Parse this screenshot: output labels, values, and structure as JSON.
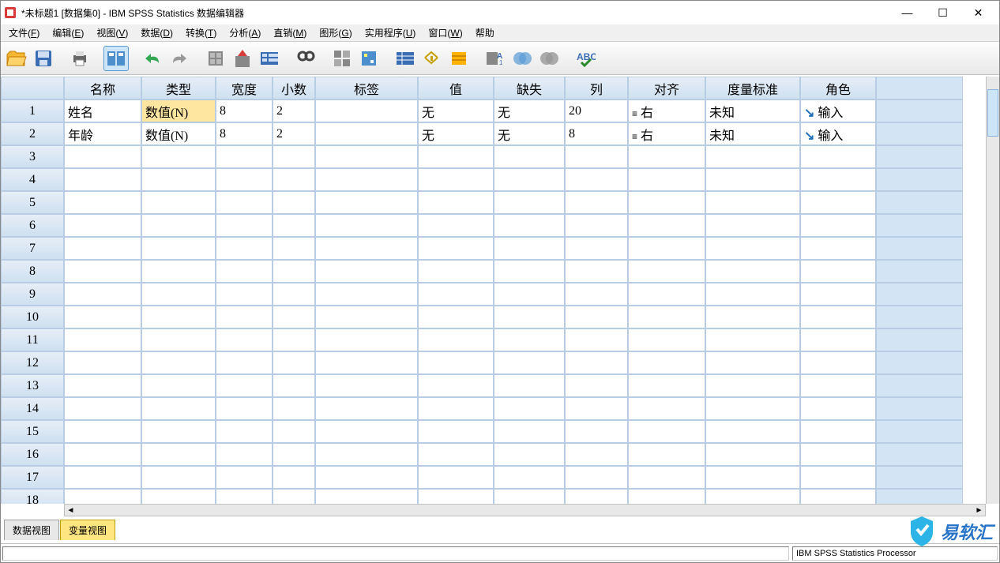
{
  "window": {
    "title": "*未标题1 [数据集0] - IBM SPSS Statistics 数据编辑器",
    "min": "—",
    "max": "☐",
    "close": "✕"
  },
  "menu": [
    {
      "label": "文件",
      "u": "F"
    },
    {
      "label": "编辑",
      "u": "E"
    },
    {
      "label": "视图",
      "u": "V"
    },
    {
      "label": "数据",
      "u": "D"
    },
    {
      "label": "转换",
      "u": "T"
    },
    {
      "label": "分析",
      "u": "A"
    },
    {
      "label": "直销",
      "u": "M"
    },
    {
      "label": "图形",
      "u": "G"
    },
    {
      "label": "实用程序",
      "u": "U"
    },
    {
      "label": "窗口",
      "u": "W"
    },
    {
      "label": "帮助",
      "u": ""
    }
  ],
  "columns": [
    "名称",
    "类型",
    "宽度",
    "小数",
    "标签",
    "值",
    "缺失",
    "列",
    "对齐",
    "度量标准",
    "角色"
  ],
  "rows": [
    {
      "n": "1",
      "name": "姓名",
      "type": "数值(N)",
      "width": "8",
      "dec": "2",
      "label": "",
      "val": "无",
      "miss": "无",
      "cols": "20",
      "align": "右",
      "meas": "未知",
      "role": "输入",
      "sel": true
    },
    {
      "n": "2",
      "name": "年龄",
      "type": "数值(N)",
      "width": "8",
      "dec": "2",
      "label": "",
      "val": "无",
      "miss": "无",
      "cols": "8",
      "align": "右",
      "meas": "未知",
      "role": "输入",
      "sel": false
    }
  ],
  "empty_rows": [
    "3",
    "4",
    "5",
    "6",
    "7",
    "8",
    "9",
    "10",
    "11",
    "12",
    "13",
    "14",
    "15",
    "16",
    "17",
    "18"
  ],
  "tabs": {
    "data": "数据视图",
    "var": "变量视图"
  },
  "status": {
    "processor": "IBM SPSS Statistics Processor"
  },
  "watermark": "易软汇"
}
